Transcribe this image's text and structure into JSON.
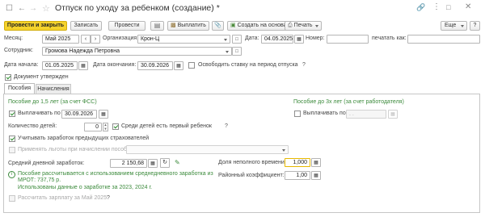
{
  "window": {
    "title": "Отпуск по уходу за ребенком (создание) *",
    "more_label": "Еще",
    "help_label": "?"
  },
  "toolbar": {
    "post_close_label": "Провести и закрыть",
    "save_label": "Записать",
    "post_label": "Провести",
    "pay_label": "Выплатить",
    "create_based_label": "Создать на основании",
    "print_label": "Печать"
  },
  "header": {
    "month_label": "Месяц:",
    "month_value": "Май 2025",
    "org_label": "Организация:",
    "org_value": "Крон-Ц",
    "date_label": "Дата:",
    "date_value": "04.05.2025",
    "number_label": "Номер:",
    "number_value": "",
    "print_as_label": "печатать как:",
    "print_as_value": "",
    "employee_label": "Сотрудник:",
    "employee_value": "Громова Надежда Петровна",
    "start_label": "Дата начала:",
    "start_value": "01.05.2025",
    "end_label": "Дата окончания:",
    "end_value": "30.09.2026",
    "free_rate_label": "Освободить ставку на период отпуска",
    "free_rate_help": "?",
    "approved_label": "Документ утвержден"
  },
  "tabs": [
    {
      "label": "Пособия",
      "active": true
    },
    {
      "label": "Начисления",
      "active": false
    }
  ],
  "benefits": {
    "fss_title": "Пособие до 1,5 лет (за счет ФСС)",
    "employer_title": "Пособие до 3х лет (за счет работодателя)",
    "pay_until_label": "Выплачивать по",
    "pay_until_value": "30.09.2026",
    "pay_until3_label": "Выплачивать по",
    "pay_until3_value": ". .",
    "children_label": "Количество детей:",
    "children_value": "0",
    "first_child_label": "Среди детей есть первый ребенок",
    "first_child_help": "?",
    "prev_employers_label": "Учитывать заработок предыдущих страхователей",
    "privileges_label": "Применять льготы при начислении пособия",
    "avg_earnings_label": "Средний дневной заработок:",
    "avg_earnings_value": "2 150,68",
    "part_time_label": "Доля неполного времени:",
    "part_time_value": "1,000",
    "regional_label": "Районный коэффициент:",
    "regional_value": "1,00",
    "info_line1": "Пособие рассчитывается с использованием среднедневного заработка из",
    "info_line2": "МРОТ: 737,75 р.",
    "info_line3": "Использованы данные о заработке за  2023,  2024 г.",
    "recalc_label": "Рассчитать зарплату за Май 2025",
    "recalc_help": "?"
  },
  "colors": {
    "primary_button": "#f5d22b",
    "green_text": "#3b8a3b",
    "focus_border": "#e6b800"
  }
}
